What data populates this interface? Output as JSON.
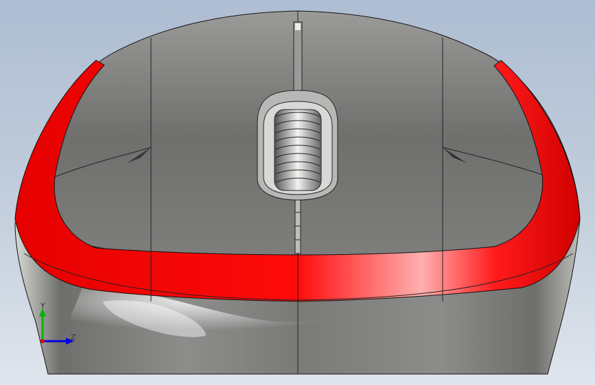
{
  "viewport": {
    "background_top": "#aebdd2",
    "background_bottom": "#dfe5ec"
  },
  "model": {
    "name": "",
    "body_color": "#8a8a88",
    "accent_color": "#ff0000",
    "edge_color": "#000000"
  },
  "triad": {
    "y_label": "Y",
    "z_label": "Z",
    "y_color": "#00b400",
    "z_color": "#0000e0",
    "x_color": "#e00000"
  }
}
